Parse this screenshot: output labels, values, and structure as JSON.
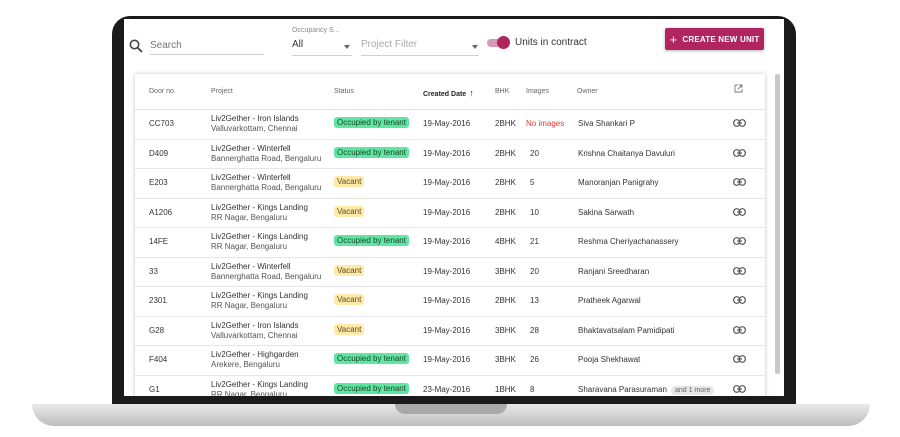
{
  "toolbar": {
    "search_placeholder": "Search",
    "occupancy_label": "Occupancy S...",
    "occupancy_value": "All",
    "project_filter_placeholder": "Project Filter",
    "units_in_contract_label": "Units in contract",
    "units_in_contract_on": true,
    "create_button_label": "CREATE NEW UNIT",
    "create_button_icon": "plus-icon"
  },
  "colors": {
    "accent": "#b0255f",
    "occupied_badge": "#5ee6a2",
    "vacant_badge": "#ffe9a8",
    "no_images_text": "#e53935"
  },
  "table": {
    "columns": {
      "door": "Door no.",
      "project": "Project",
      "status": "Status",
      "created": "Created Date",
      "bhk": "BHK",
      "images": "Images",
      "owner": "Owner"
    },
    "sorted_column": "created",
    "sort_icon": "arrow-up-icon",
    "header_icon": "open-in-new-icon",
    "row_icon": "link-icon",
    "rows": [
      {
        "door": "CC703",
        "project": "Liv2Gether - Iron Islands",
        "location": "Valluvarkottam, Chennai",
        "status": "Occupied by tenant",
        "status_type": "occupied",
        "created": "19-May-2016",
        "bhk": "2BHK",
        "images": "No images",
        "owner": "Siva Shankari P",
        "more": ""
      },
      {
        "door": "D409",
        "project": "Liv2Gether - Winterfell",
        "location": "Bannerghatta Road, Bengaluru",
        "status": "Occupied by tenant",
        "status_type": "occupied",
        "created": "19-May-2016",
        "bhk": "2BHK",
        "images": "20",
        "owner": "Krishna Chaitanya Davuluri",
        "more": ""
      },
      {
        "door": "E203",
        "project": "Liv2Gether - Winterfell",
        "location": "Bannerghatta Road, Bengaluru",
        "status": "Vacant",
        "status_type": "vacant",
        "created": "19-May-2016",
        "bhk": "2BHK",
        "images": "5",
        "owner": "Manoranjan Panigrahy",
        "more": ""
      },
      {
        "door": "A1206",
        "project": "Liv2Gether - Kings Landing",
        "location": "RR Nagar, Bengaluru",
        "status": "Vacant",
        "status_type": "vacant",
        "created": "19-May-2016",
        "bhk": "2BHK",
        "images": "10",
        "owner": "Sakina Sarwath",
        "more": ""
      },
      {
        "door": "14FE",
        "project": "Liv2Gether - Kings Landing",
        "location": "RR Nagar, Bengaluru",
        "status": "Occupied by tenant",
        "status_type": "occupied",
        "created": "19-May-2016",
        "bhk": "4BHK",
        "images": "21",
        "owner": "Reshma Cheriyachanassery",
        "more": ""
      },
      {
        "door": "33",
        "project": "Liv2Gether - Winterfell",
        "location": "Bannerghatta Road, Bengaluru",
        "status": "Vacant",
        "status_type": "vacant",
        "created": "19-May-2016",
        "bhk": "3BHK",
        "images": "20",
        "owner": "Ranjani Sreedharan",
        "more": ""
      },
      {
        "door": "2301",
        "project": "Liv2Gether - Kings Landing",
        "location": "RR Nagar, Bengaluru",
        "status": "Vacant",
        "status_type": "vacant",
        "created": "19-May-2016",
        "bhk": "2BHK",
        "images": "13",
        "owner": "Pratheek Agarwal",
        "more": ""
      },
      {
        "door": "G28",
        "project": "Liv2Gether - Iron Islands",
        "location": "Valluvarkottam, Chennai",
        "status": "Vacant",
        "status_type": "vacant",
        "created": "19-May-2016",
        "bhk": "3BHK",
        "images": "28",
        "owner": "Bhaktavatsalam Pamidipati",
        "more": ""
      },
      {
        "door": "F404",
        "project": "Liv2Gether - Highgarden",
        "location": "Arekere, Bengaluru",
        "status": "Occupied by tenant",
        "status_type": "occupied",
        "created": "19-May-2016",
        "bhk": "3BHK",
        "images": "26",
        "owner": "Pooja Shekhawat",
        "more": ""
      },
      {
        "door": "G1",
        "project": "Liv2Gether - Kings Landing",
        "location": "RR Nagar, Bengaluru",
        "status": "Occupied by tenant",
        "status_type": "occupied",
        "created": "23-May-2016",
        "bhk": "1BHK",
        "images": "8",
        "owner": "Sharavana Parasuraman",
        "more": "and 1 more"
      }
    ]
  }
}
